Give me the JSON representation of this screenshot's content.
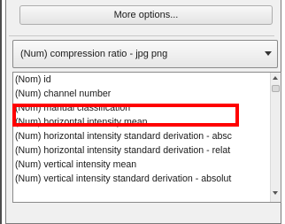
{
  "more_options_label": "More options...",
  "combo": {
    "selected": "(Num) compression ratio - jpg png"
  },
  "list": {
    "items": [
      "(Nom) id",
      "(Num) channel number",
      "(Nom) manual classification",
      "(Num) horizontal intensity mean",
      "(Num) horizontal intensity standard derivation - absc",
      "(Num) horizontal intensity standard derivation - relat",
      "(Num) vertical intensity mean",
      "(Num) vertical intensity standard derivation - absolut"
    ],
    "highlighted_item": "(Nom) manual classification"
  },
  "colors": {
    "highlight": "#ff0000"
  }
}
